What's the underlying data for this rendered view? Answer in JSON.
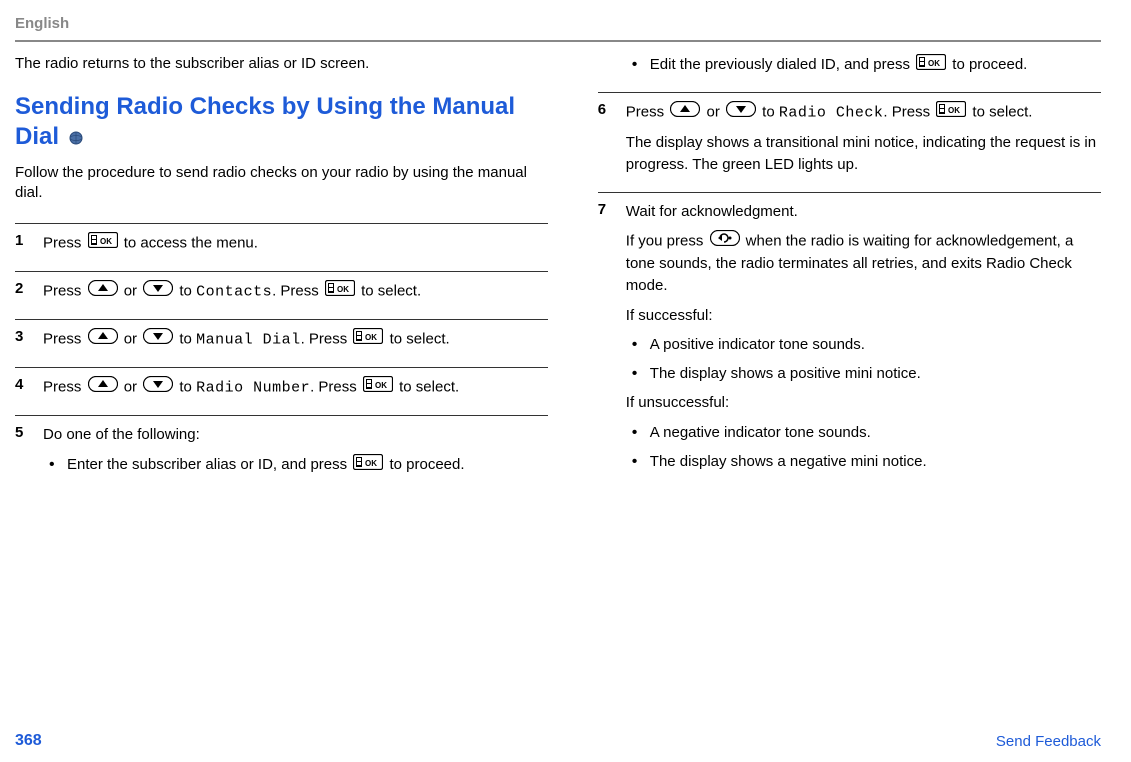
{
  "header": {
    "language": "English"
  },
  "left": {
    "intro": "The radio returns to the subscriber alias or ID screen.",
    "heading": "Sending Radio Checks by Using the Manual Dial",
    "follow": "Follow the procedure to send radio checks on your radio by using the manual dial.",
    "steps": {
      "s1": {
        "num": "1",
        "t1": "Press ",
        "t2": " to access the menu."
      },
      "s2": {
        "num": "2",
        "t1": "Press ",
        "t2": " or ",
        "t3": " to ",
        "menu": "Contacts",
        "t4": ". Press ",
        "t5": " to select."
      },
      "s3": {
        "num": "3",
        "t1": "Press ",
        "t2": " or ",
        "t3": " to ",
        "menu": "Manual Dial",
        "t4": ". Press ",
        "t5": " to select."
      },
      "s4": {
        "num": "4",
        "t1": "Press ",
        "t2": " or ",
        "t3": " to ",
        "menu": "Radio Number",
        "t4": ". Press ",
        "t5": " to select."
      },
      "s5": {
        "num": "5",
        "title": "Do one of the following:",
        "b1a": "Enter the subscriber alias or ID, and press ",
        "b1b": " to proceed."
      }
    }
  },
  "right": {
    "s5b": {
      "a": "Edit the previously dialed ID, and press ",
      "b": " to proceed."
    },
    "s6": {
      "num": "6",
      "t1": "Press ",
      "t2": " or ",
      "t3": " to ",
      "menu": "Radio Check",
      "t4": ". Press ",
      "t5": " to select.",
      "note": "The display shows a transitional mini notice, indicating the request is in progress. The green LED lights up."
    },
    "s7": {
      "num": "7",
      "title": "Wait for acknowledgment.",
      "p1a": "If you press ",
      "p1b": " when the radio is waiting for acknowledgement, a tone sounds, the radio terminates all retries, and exits Radio Check mode.",
      "succ": "If successful:",
      "succ_b1": "A positive indicator tone sounds.",
      "succ_b2": "The display shows a positive mini notice.",
      "unsucc": "If unsuccessful:",
      "unsucc_b1": "A negative indicator tone sounds.",
      "unsucc_b2": "The display shows a negative mini notice."
    }
  },
  "footer": {
    "page": "368",
    "feedback": "Send Feedback"
  },
  "icons": {
    "ok_button": "ok",
    "up_button": "up",
    "down_button": "down",
    "back_button": "back"
  }
}
